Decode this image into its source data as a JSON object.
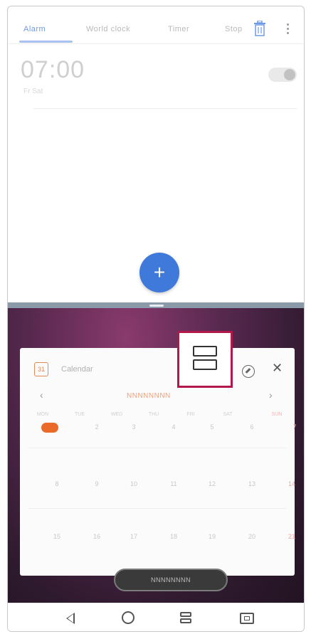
{
  "clock": {
    "tabs": [
      "Alarm",
      "World clock",
      "Timer",
      "Stop"
    ],
    "alarm": {
      "time": "07:00",
      "repeat": "Fr Sat"
    }
  },
  "calendar": {
    "title": "Calendar",
    "month": "NNNNNNNN",
    "weekdays": [
      "MON",
      "TUE",
      "WED",
      "THU",
      "FRI",
      "SAT",
      "SUN"
    ],
    "rows": [
      [
        "1",
        "2",
        "3",
        "4",
        "5",
        "6",
        "7"
      ],
      [
        "8",
        "9",
        "10",
        "11",
        "12",
        "13",
        "14"
      ],
      [
        "15",
        "16",
        "17",
        "18",
        "19",
        "20",
        "21"
      ]
    ],
    "bottom_button": "NNNNNNNN"
  },
  "colors": {
    "fab": "#3f79d9",
    "today": "#ea6a2a",
    "highlight": "#b2184a"
  },
  "icons": [
    "trash-icon",
    "more-icon",
    "add-icon",
    "calendar-icon",
    "pin-icon",
    "close-icon",
    "split-screen-icon",
    "back-icon",
    "home-icon",
    "recents-icon"
  ]
}
